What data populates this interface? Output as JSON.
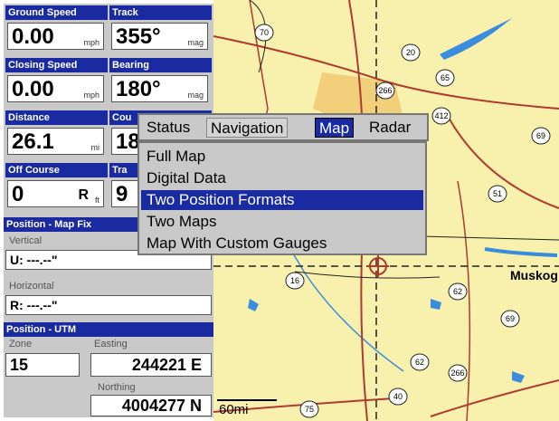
{
  "gauges": {
    "ground_speed": {
      "title": "Ground Speed",
      "value": "0.00",
      "unit": "mph"
    },
    "track": {
      "title": "Track",
      "value": "355°",
      "unit": "mag"
    },
    "closing_speed": {
      "title": "Closing Speed",
      "value": "0.00",
      "unit": "mph"
    },
    "bearing": {
      "title": "Bearing",
      "value": "180°",
      "unit": "mag"
    },
    "distance": {
      "title": "Distance",
      "value": "26.1",
      "unit": "mi"
    },
    "course": {
      "title": "Cou",
      "value": "18"
    },
    "off_course": {
      "title": "Off Course",
      "value": "0",
      "dir": "R",
      "unit": "ft"
    },
    "track2": {
      "title": "Tra",
      "value": "9"
    }
  },
  "position_map_fix": {
    "title": "Position - Map Fix",
    "vertical_label": "Vertical",
    "vertical_value": "U:  ---.--\"",
    "horizontal_label": "Horizontal",
    "horizontal_value": "R:  ---.--\""
  },
  "position_utm": {
    "title": "Position - UTM",
    "zone_label": "Zone",
    "zone_value": "15",
    "easting_label": "Easting",
    "easting_value": "244221 E",
    "northing_label": "Northing",
    "northing_value": "4004277 N"
  },
  "map": {
    "scale": "60mi",
    "city": "Muskog",
    "shields": [
      "70",
      "20",
      "266",
      "65",
      "412",
      "69",
      "51",
      "16",
      "62",
      "69",
      "62",
      "266",
      "40",
      "75"
    ],
    "colors": {
      "land": "#f7f1ad",
      "road": "#b03a2e",
      "water": "#3a8ddc",
      "city": "#f2cf7a"
    }
  },
  "tabs": [
    {
      "label": "Status"
    },
    {
      "label": "Navigation"
    },
    {
      "label": "Map"
    },
    {
      "label": "Radar"
    }
  ],
  "menu": [
    {
      "label": "Full Map"
    },
    {
      "label": "Digital Data"
    },
    {
      "label": "Two Position Formats"
    },
    {
      "label": "Two Maps"
    },
    {
      "label": "Map With Custom Gauges"
    }
  ]
}
